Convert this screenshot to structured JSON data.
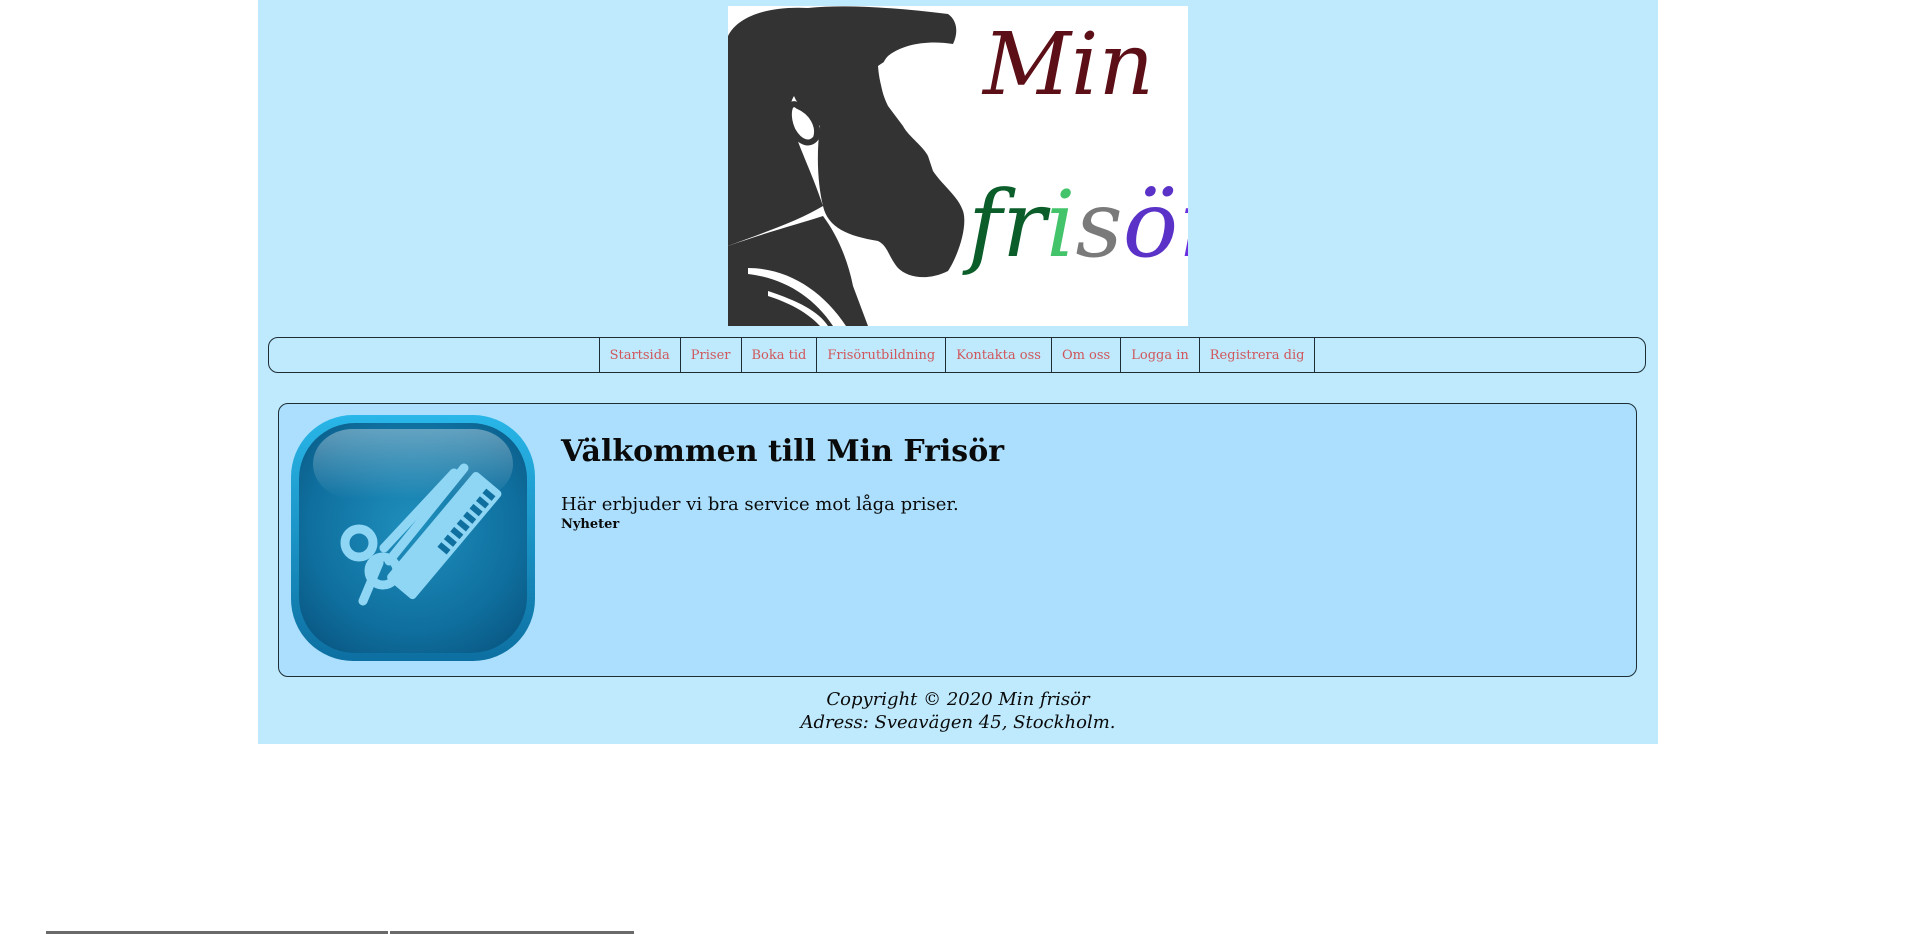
{
  "colors": {
    "page_background": "#bfeafd",
    "panel_background": "#abdffd",
    "nav_text": "#d0565b",
    "border": "#1d2d35"
  },
  "logo": {
    "icon": "bearded-man-profile-logo",
    "word_min": "Min",
    "word_frisor": "frisör"
  },
  "nav": {
    "items": [
      {
        "label": "Startsida"
      },
      {
        "label": "Priser"
      },
      {
        "label": "Boka tid"
      },
      {
        "label": "Frisörutbildning"
      },
      {
        "label": "Kontakta oss"
      },
      {
        "label": "Om oss"
      },
      {
        "label": "Logga in"
      },
      {
        "label": "Registrera dig"
      }
    ]
  },
  "main": {
    "icon": "scissors-comb-icon",
    "heading": "Välkommen till Min Frisör",
    "intro": "Här erbjuder vi bra service mot låga priser.",
    "news_label": "Nyheter"
  },
  "footer": {
    "copyright": "Copyright © 2020 Min frisör",
    "address": "Adress: Sveavägen 45, Stockholm."
  }
}
